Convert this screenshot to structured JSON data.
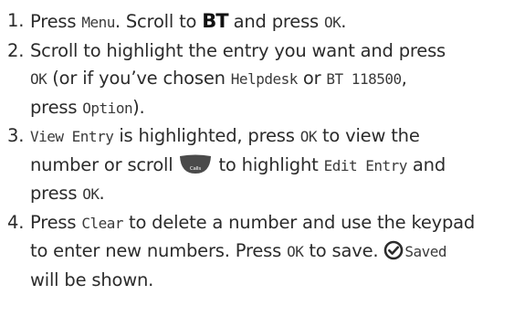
{
  "steps": [
    {
      "number": "1.",
      "t1": "Press ",
      "k1": "Menu",
      "t2": ". Scroll to ",
      "logo": "BT",
      "t3": " and press ",
      "k2": "OK",
      "t4": "."
    },
    {
      "number": "2.",
      "t1": "Scroll to highlight the entry you want and press",
      "k1": "OK",
      "t2": " (or if you’ve chosen ",
      "k2": "Helpdesk",
      "t3": " or ",
      "k3": "BT 118500",
      "t4": ",",
      "t5": "press ",
      "k4": "Option",
      "t6": ")."
    },
    {
      "number": "3.",
      "k1": "View Entry",
      "t1": " is highlighted, press ",
      "k2": "OK",
      "t2": " to view the",
      "t3": "number or scroll ",
      "icon_label": "Calls",
      "t4": " to highlight ",
      "k3": "Edit Entry",
      "t5": " and",
      "t6": "press ",
      "k4": "OK",
      "t7": "."
    },
    {
      "number": "4.",
      "t1": "Press ",
      "k1": "Clear",
      "t2": " to delete a number and use the keypad",
      "t3": "to enter new numbers. Press ",
      "k2": "OK",
      "t4": " to save. ",
      "k3": "Saved",
      "t5": "will be shown."
    }
  ],
  "icons": {
    "nav": "calls-scroll-down-icon",
    "saved": "tick-circle-icon",
    "nav_color": "#4a4a4a",
    "saved_color": "#2b2b2b"
  }
}
